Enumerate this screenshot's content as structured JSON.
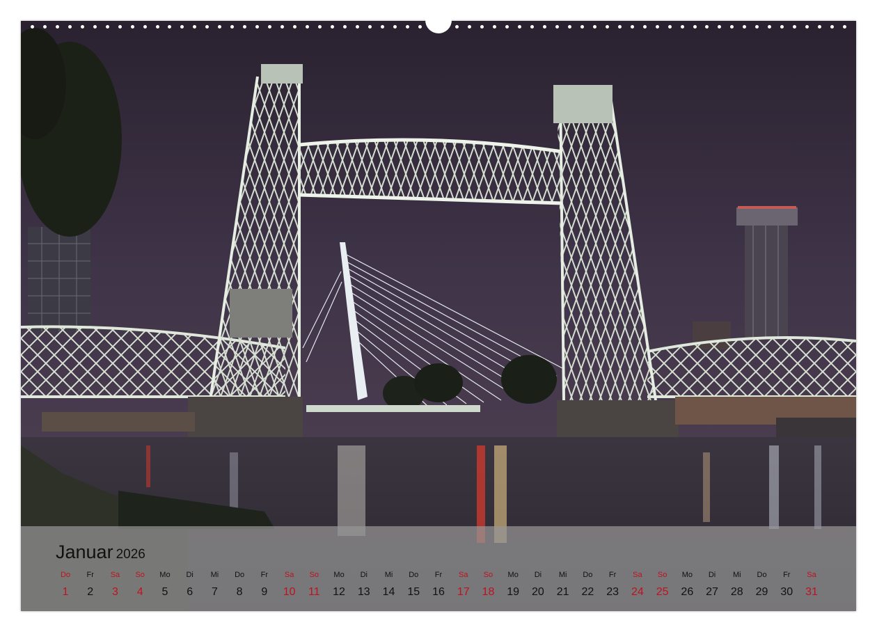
{
  "calendar": {
    "month": "Januar",
    "year": "2026",
    "weekend_color": "#c0111f",
    "text_color": "#111111",
    "days": [
      {
        "d": "Do",
        "n": "1",
        "red": true
      },
      {
        "d": "Fr",
        "n": "2",
        "red": false
      },
      {
        "d": "Sa",
        "n": "3",
        "red": true
      },
      {
        "d": "So",
        "n": "4",
        "red": true
      },
      {
        "d": "Mo",
        "n": "5",
        "red": false
      },
      {
        "d": "Di",
        "n": "6",
        "red": false
      },
      {
        "d": "Mi",
        "n": "7",
        "red": false
      },
      {
        "d": "Do",
        "n": "8",
        "red": false
      },
      {
        "d": "Fr",
        "n": "9",
        "red": false
      },
      {
        "d": "Sa",
        "n": "10",
        "red": true
      },
      {
        "d": "So",
        "n": "11",
        "red": true
      },
      {
        "d": "Mo",
        "n": "12",
        "red": false
      },
      {
        "d": "Di",
        "n": "13",
        "red": false
      },
      {
        "d": "Mi",
        "n": "14",
        "red": false
      },
      {
        "d": "Do",
        "n": "15",
        "red": false
      },
      {
        "d": "Fr",
        "n": "16",
        "red": false
      },
      {
        "d": "Sa",
        "n": "17",
        "red": true
      },
      {
        "d": "So",
        "n": "18",
        "red": true
      },
      {
        "d": "Mo",
        "n": "19",
        "red": false
      },
      {
        "d": "Di",
        "n": "20",
        "red": false
      },
      {
        "d": "Mi",
        "n": "21",
        "red": false
      },
      {
        "d": "Do",
        "n": "22",
        "red": false
      },
      {
        "d": "Fr",
        "n": "23",
        "red": false
      },
      {
        "d": "Sa",
        "n": "24",
        "red": true
      },
      {
        "d": "So",
        "n": "25",
        "red": true
      },
      {
        "d": "Mo",
        "n": "26",
        "red": false
      },
      {
        "d": "Di",
        "n": "27",
        "red": false
      },
      {
        "d": "Mi",
        "n": "28",
        "red": false
      },
      {
        "d": "Do",
        "n": "29",
        "red": false
      },
      {
        "d": "Fr",
        "n": "30",
        "red": false
      },
      {
        "d": "Sa",
        "n": "31",
        "red": true
      }
    ]
  },
  "photo": {
    "subject": "night-bridge-photo",
    "sky_color": "#3a2f45",
    "water_color": "#2f2a35",
    "steel_color": "#cfd8cc"
  }
}
